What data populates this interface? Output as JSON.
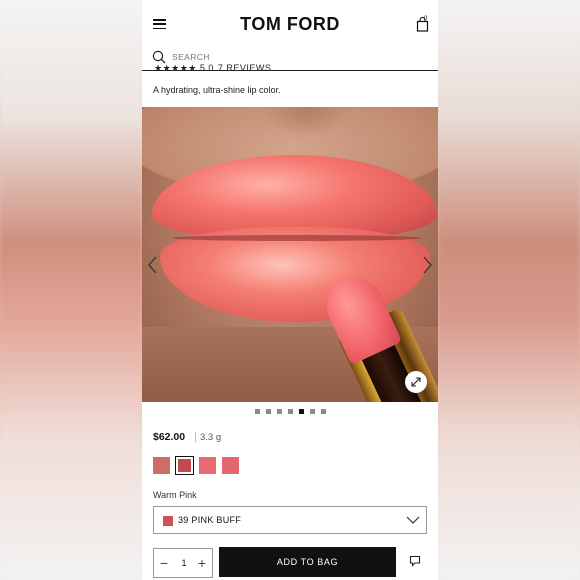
{
  "header": {
    "logo": "TOM FORD",
    "bag_count": "0",
    "menu_icon": "hamburger-menu-icon",
    "bag_icon": "shopping-bag-icon"
  },
  "search": {
    "placeholder": "SEARCH",
    "icon": "search-icon"
  },
  "rating": {
    "stars_text": "★★★★★ 5.0",
    "reviews_link": "7 REVIEWS"
  },
  "product": {
    "description": "A hydrating, ultra-shine lip color.",
    "price": "$62.00",
    "weight": "3.3 g",
    "shade_family": "Warm Pink",
    "selected_shade": "39 PINK BUFF",
    "selected_shade_color": "#d24f57",
    "quantity": "1"
  },
  "gallery": {
    "image_count": 7,
    "active_index": 4
  },
  "swatches": [
    {
      "color": "#c96e68",
      "selected": false
    },
    {
      "color": "#c24a4e",
      "selected": true
    },
    {
      "color": "#e56a72",
      "selected": false
    },
    {
      "color": "#e16771",
      "selected": false
    }
  ],
  "actions": {
    "add_to_bag": "ADD TO BAG",
    "minus": "−",
    "plus": "+",
    "chat_icon": "chat-bubble-icon",
    "zoom_icon": "expand-icon"
  }
}
